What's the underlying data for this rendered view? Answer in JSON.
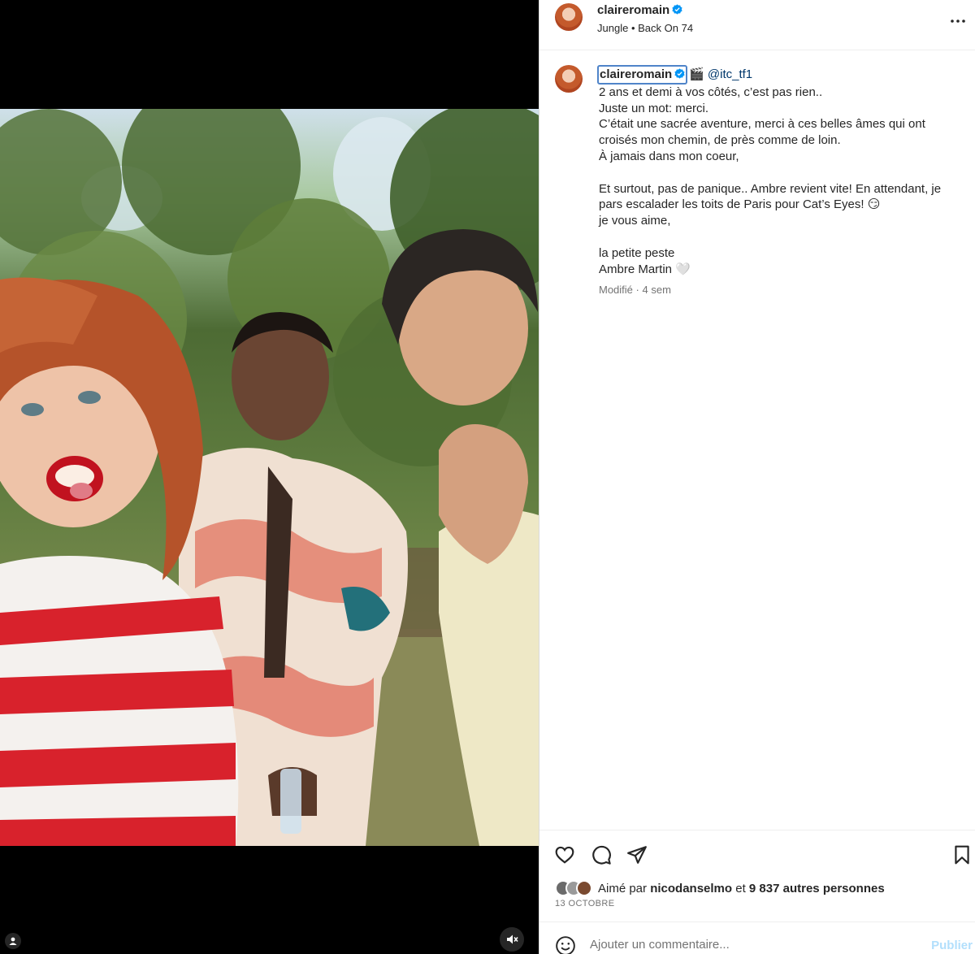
{
  "post": {
    "username": "claireromain",
    "audio": "Jungle",
    "audio_sep": "•",
    "track": "Back On 74"
  },
  "caption": {
    "username": "claireromain",
    "clapper": "🎬",
    "mention": "@itc_tf1",
    "text": "2 ans et demi à vos côtés, c’est pas rien..\nJuste un mot: merci.\nC’était une sacrée aventure, merci à ces belles âmes qui ont croisés mon chemin, de près comme de loin.\nÀ jamais dans mon coeur,\n\nEt surtout, pas de panique.. Ambre revient vite! En attendant, je pars escalader les toits de Paris pour Cat’s Eyes! 😏\nje vous aime,\n\nla petite peste\nAmbre Martin 🤍",
    "edited": "Modifié",
    "meta_sep": "·",
    "age": "4 sem"
  },
  "likes": {
    "prefix": "Aimé par",
    "liker": "nicodanselmo",
    "connector": "et",
    "count_text": "9 837 autres personnes"
  },
  "date": "13 OCTOBRE",
  "comment": {
    "placeholder": "Ajouter un commentaire...",
    "publish": "Publier"
  },
  "icons": {
    "verified": "verified-badge-icon",
    "more": "more-options-icon",
    "like": "heart-icon",
    "comment": "comment-bubble-icon",
    "share": "paper-plane-icon",
    "save": "bookmark-icon",
    "emoji": "smiley-icon",
    "mute": "speaker-muted-icon",
    "tags": "user-tag-icon"
  },
  "colors": {
    "verified": "#0095f6",
    "mention": "#00376b",
    "publish": "#b2dffc"
  }
}
